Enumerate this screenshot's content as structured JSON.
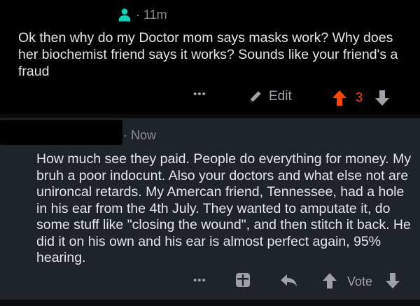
{
  "comment_own": {
    "timestamp": "· 11m",
    "body": "Ok then why do my Doctor mom says masks work? Why does her biochemist friend says it works? Sounds like your friend's a fraud",
    "more_label": "•••",
    "edit_label": "Edit",
    "score": "3",
    "upvote_color": "#ff4500"
  },
  "comment_reply": {
    "timestamp": "· Now",
    "body": "How much see they paid. People do everything for money. My bruh a poor indocunt. Also your doctors and what else not are unironcal retards. My Amercan friend, Tennessee, had a hole in his ear from the 4th July. They wanted to amputate it, do some stuff like \"closing the wound\", and then stitch it back. He did it on his own and his ear is almost perfect again, 95% hearing.",
    "more_label": "•••",
    "vote_label": "Vote"
  },
  "icons": [
    "user-icon",
    "more-icon",
    "pencil-icon",
    "upvote-icon",
    "downvote-icon",
    "award-icon",
    "reply-icon"
  ],
  "colors": {
    "own_bg": "#000000",
    "reply_bg": "#1f242b",
    "text": "#e4e6e8",
    "meta": "#8a8d91",
    "user_icon": "#0dd3bb"
  }
}
